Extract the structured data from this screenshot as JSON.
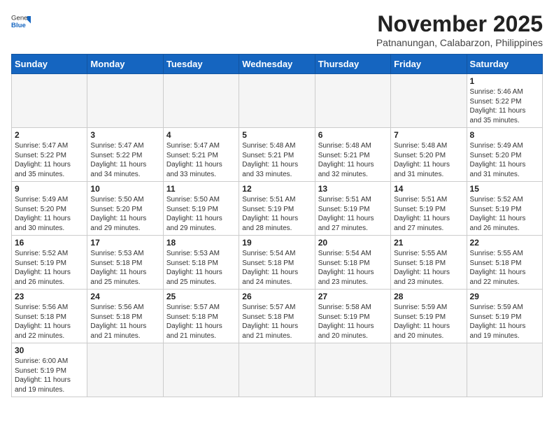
{
  "header": {
    "logo_general": "General",
    "logo_blue": "Blue",
    "month_title": "November 2025",
    "location": "Patnanungan, Calabarzon, Philippines"
  },
  "weekdays": [
    "Sunday",
    "Monday",
    "Tuesday",
    "Wednesday",
    "Thursday",
    "Friday",
    "Saturday"
  ],
  "weeks": [
    [
      {
        "day": "",
        "content": ""
      },
      {
        "day": "",
        "content": ""
      },
      {
        "day": "",
        "content": ""
      },
      {
        "day": "",
        "content": ""
      },
      {
        "day": "",
        "content": ""
      },
      {
        "day": "",
        "content": ""
      },
      {
        "day": "1",
        "content": "Sunrise: 5:46 AM\nSunset: 5:22 PM\nDaylight: 11 hours\nand 35 minutes."
      }
    ],
    [
      {
        "day": "2",
        "content": "Sunrise: 5:47 AM\nSunset: 5:22 PM\nDaylight: 11 hours\nand 35 minutes."
      },
      {
        "day": "3",
        "content": "Sunrise: 5:47 AM\nSunset: 5:22 PM\nDaylight: 11 hours\nand 34 minutes."
      },
      {
        "day": "4",
        "content": "Sunrise: 5:47 AM\nSunset: 5:21 PM\nDaylight: 11 hours\nand 33 minutes."
      },
      {
        "day": "5",
        "content": "Sunrise: 5:48 AM\nSunset: 5:21 PM\nDaylight: 11 hours\nand 33 minutes."
      },
      {
        "day": "6",
        "content": "Sunrise: 5:48 AM\nSunset: 5:21 PM\nDaylight: 11 hours\nand 32 minutes."
      },
      {
        "day": "7",
        "content": "Sunrise: 5:48 AM\nSunset: 5:20 PM\nDaylight: 11 hours\nand 31 minutes."
      },
      {
        "day": "8",
        "content": "Sunrise: 5:49 AM\nSunset: 5:20 PM\nDaylight: 11 hours\nand 31 minutes."
      }
    ],
    [
      {
        "day": "9",
        "content": "Sunrise: 5:49 AM\nSunset: 5:20 PM\nDaylight: 11 hours\nand 30 minutes."
      },
      {
        "day": "10",
        "content": "Sunrise: 5:50 AM\nSunset: 5:20 PM\nDaylight: 11 hours\nand 29 minutes."
      },
      {
        "day": "11",
        "content": "Sunrise: 5:50 AM\nSunset: 5:19 PM\nDaylight: 11 hours\nand 29 minutes."
      },
      {
        "day": "12",
        "content": "Sunrise: 5:51 AM\nSunset: 5:19 PM\nDaylight: 11 hours\nand 28 minutes."
      },
      {
        "day": "13",
        "content": "Sunrise: 5:51 AM\nSunset: 5:19 PM\nDaylight: 11 hours\nand 27 minutes."
      },
      {
        "day": "14",
        "content": "Sunrise: 5:51 AM\nSunset: 5:19 PM\nDaylight: 11 hours\nand 27 minutes."
      },
      {
        "day": "15",
        "content": "Sunrise: 5:52 AM\nSunset: 5:19 PM\nDaylight: 11 hours\nand 26 minutes."
      }
    ],
    [
      {
        "day": "16",
        "content": "Sunrise: 5:52 AM\nSunset: 5:19 PM\nDaylight: 11 hours\nand 26 minutes."
      },
      {
        "day": "17",
        "content": "Sunrise: 5:53 AM\nSunset: 5:18 PM\nDaylight: 11 hours\nand 25 minutes."
      },
      {
        "day": "18",
        "content": "Sunrise: 5:53 AM\nSunset: 5:18 PM\nDaylight: 11 hours\nand 25 minutes."
      },
      {
        "day": "19",
        "content": "Sunrise: 5:54 AM\nSunset: 5:18 PM\nDaylight: 11 hours\nand 24 minutes."
      },
      {
        "day": "20",
        "content": "Sunrise: 5:54 AM\nSunset: 5:18 PM\nDaylight: 11 hours\nand 23 minutes."
      },
      {
        "day": "21",
        "content": "Sunrise: 5:55 AM\nSunset: 5:18 PM\nDaylight: 11 hours\nand 23 minutes."
      },
      {
        "day": "22",
        "content": "Sunrise: 5:55 AM\nSunset: 5:18 PM\nDaylight: 11 hours\nand 22 minutes."
      }
    ],
    [
      {
        "day": "23",
        "content": "Sunrise: 5:56 AM\nSunset: 5:18 PM\nDaylight: 11 hours\nand 22 minutes."
      },
      {
        "day": "24",
        "content": "Sunrise: 5:56 AM\nSunset: 5:18 PM\nDaylight: 11 hours\nand 21 minutes."
      },
      {
        "day": "25",
        "content": "Sunrise: 5:57 AM\nSunset: 5:18 PM\nDaylight: 11 hours\nand 21 minutes."
      },
      {
        "day": "26",
        "content": "Sunrise: 5:57 AM\nSunset: 5:18 PM\nDaylight: 11 hours\nand 21 minutes."
      },
      {
        "day": "27",
        "content": "Sunrise: 5:58 AM\nSunset: 5:19 PM\nDaylight: 11 hours\nand 20 minutes."
      },
      {
        "day": "28",
        "content": "Sunrise: 5:59 AM\nSunset: 5:19 PM\nDaylight: 11 hours\nand 20 minutes."
      },
      {
        "day": "29",
        "content": "Sunrise: 5:59 AM\nSunset: 5:19 PM\nDaylight: 11 hours\nand 19 minutes."
      }
    ],
    [
      {
        "day": "30",
        "content": "Sunrise: 6:00 AM\nSunset: 5:19 PM\nDaylight: 11 hours\nand 19 minutes."
      },
      {
        "day": "",
        "content": ""
      },
      {
        "day": "",
        "content": ""
      },
      {
        "day": "",
        "content": ""
      },
      {
        "day": "",
        "content": ""
      },
      {
        "day": "",
        "content": ""
      },
      {
        "day": "",
        "content": ""
      }
    ]
  ]
}
